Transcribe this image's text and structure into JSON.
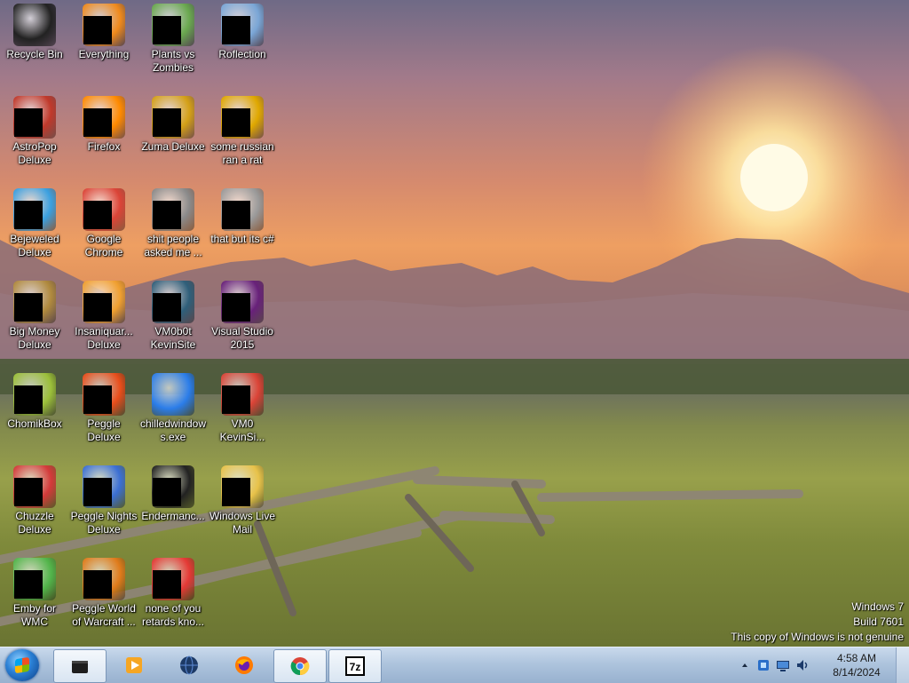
{
  "desktop_icons": [
    {
      "label": "Recycle Bin",
      "icon": "recycle-bin-icon",
      "color": "#222222",
      "redacted": false
    },
    {
      "label": "Everything",
      "icon": "everything-search-icon",
      "color": "#f08a1c",
      "redacted": true
    },
    {
      "label": "Plants vs Zombies",
      "icon": "plants-vs-zombies-icon",
      "color": "#6aa84f",
      "redacted": true
    },
    {
      "label": "Roflection",
      "icon": "roflection-icon",
      "color": "#7aa6d6",
      "redacted": true
    },
    {
      "label": "AstroPop Deluxe",
      "icon": "astropop-icon",
      "color": "#c0392b",
      "redacted": true
    },
    {
      "label": "Firefox",
      "icon": "firefox-icon",
      "color": "#ff8a00",
      "redacted": true
    },
    {
      "label": "Zuma Deluxe",
      "icon": "zuma-icon",
      "color": "#d4a017",
      "redacted": true
    },
    {
      "label": "some russian ran a rat",
      "icon": "shortcut-icon",
      "color": "#e0a800",
      "redacted": true
    },
    {
      "label": "Bejeweled Deluxe",
      "icon": "bejeweled-icon",
      "color": "#3aa0e0",
      "redacted": true
    },
    {
      "label": "Google Chrome",
      "icon": "chrome-icon",
      "color": "#db4437",
      "redacted": true
    },
    {
      "label": "shit people asked me ...",
      "icon": "folder-icon",
      "color": "#8a8a8a",
      "redacted": true
    },
    {
      "label": "that but its c#",
      "icon": "file-icon",
      "color": "#9a9a9a",
      "redacted": true
    },
    {
      "label": "Big Money Deluxe",
      "icon": "big-money-icon",
      "color": "#b08a3e",
      "redacted": true
    },
    {
      "label": "Insaniquar... Deluxe",
      "icon": "insaniquarium-icon",
      "color": "#f0a030",
      "redacted": true
    },
    {
      "label": "VM0b0t KevinSite",
      "icon": "vm-icon",
      "color": "#2f5f7a",
      "redacted": true
    },
    {
      "label": "Visual Studio 2015",
      "icon": "visual-studio-icon",
      "color": "#68217a",
      "redacted": true
    },
    {
      "label": "ChomikBox",
      "icon": "chomikbox-icon",
      "color": "#9bbf3a",
      "redacted": true
    },
    {
      "label": "Peggle Deluxe",
      "icon": "peggle-icon",
      "color": "#e94e1b",
      "redacted": true
    },
    {
      "label": "chilledwindows.exe",
      "icon": "windows-flag-icon",
      "color": "#2b7de9",
      "redacted": false
    },
    {
      "label": "VM0 KevinSi...",
      "icon": "chrome-icon",
      "color": "#db4437",
      "redacted": true
    },
    {
      "label": "Chuzzle Deluxe",
      "icon": "chuzzle-icon",
      "color": "#d43a3a",
      "redacted": true
    },
    {
      "label": "Peggle Nights Deluxe",
      "icon": "peggle-nights-icon",
      "color": "#3b6fd4",
      "redacted": true
    },
    {
      "label": "Endermanc...",
      "icon": "terminal-icon",
      "color": "#222222",
      "redacted": true
    },
    {
      "label": "Windows Live Mail",
      "icon": "mail-icon",
      "color": "#e8c24a",
      "redacted": true
    },
    {
      "label": "Emby for WMC",
      "icon": "emby-icon",
      "color": "#52b54b",
      "redacted": true
    },
    {
      "label": "Peggle World of Warcraft ...",
      "icon": "peggle-wow-icon",
      "color": "#e07b1b",
      "redacted": true
    },
    {
      "label": "none of you retards kno...",
      "icon": "chrome-icon",
      "color": "#e53935",
      "redacted": true
    }
  ],
  "watermark": {
    "line1": "Windows 7",
    "line2": "Build 7601",
    "line3": "This copy of Windows is not genuine"
  },
  "taskbar": {
    "start_button": "start-orb-icon",
    "pinned": [
      {
        "name": "generic-app-icon",
        "color": "#1e1e1e",
        "active": true
      },
      {
        "name": "media-player-icon",
        "color": "#f0a020",
        "active": false
      },
      {
        "name": "globe-icon",
        "color": "#1d3a66",
        "active": false
      },
      {
        "name": "firefox-icon",
        "color": "#ff7a00",
        "active": false
      },
      {
        "name": "chrome-icon",
        "color": "#db4437",
        "active": true
      },
      {
        "name": "7zip-icon",
        "color": "#000000",
        "active": true
      }
    ],
    "tray": {
      "time": "4:58 AM",
      "date": "8/14/2024"
    }
  }
}
